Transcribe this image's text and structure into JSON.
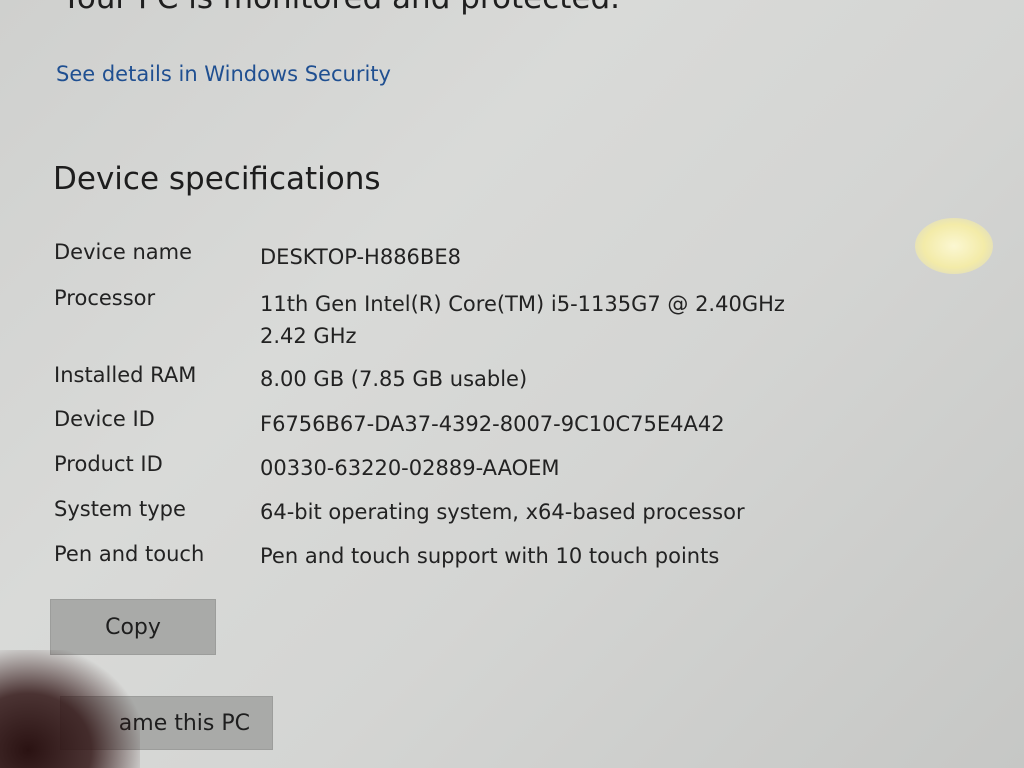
{
  "protection": {
    "status_text": "Your PC is monitored and protected.",
    "security_link": "See details in Windows Security"
  },
  "device_specs": {
    "title": "Device specifications",
    "rows": [
      {
        "label": "Device name",
        "value": "DESKTOP-H886BE8"
      },
      {
        "label": "Processor",
        "value": "11th Gen Intel(R) Core(TM) i5-1135G7 @ 2.40GHz",
        "value_line2": "2.42 GHz"
      },
      {
        "label": "Installed RAM",
        "value": "8.00 GB (7.85 GB usable)"
      },
      {
        "label": "Device ID",
        "value": "F6756B67-DA37-4392-8007-9C10C75E4A42"
      },
      {
        "label": "Product ID",
        "value": "00330-63220-02889-AAOEM"
      },
      {
        "label": "System type",
        "value": "64-bit operating system, x64-based processor"
      },
      {
        "label": "Pen and touch",
        "value": "Pen and touch support with 10 touch points"
      }
    ]
  },
  "buttons": {
    "copy_label": "Copy",
    "rename_label": "ame this PC"
  }
}
